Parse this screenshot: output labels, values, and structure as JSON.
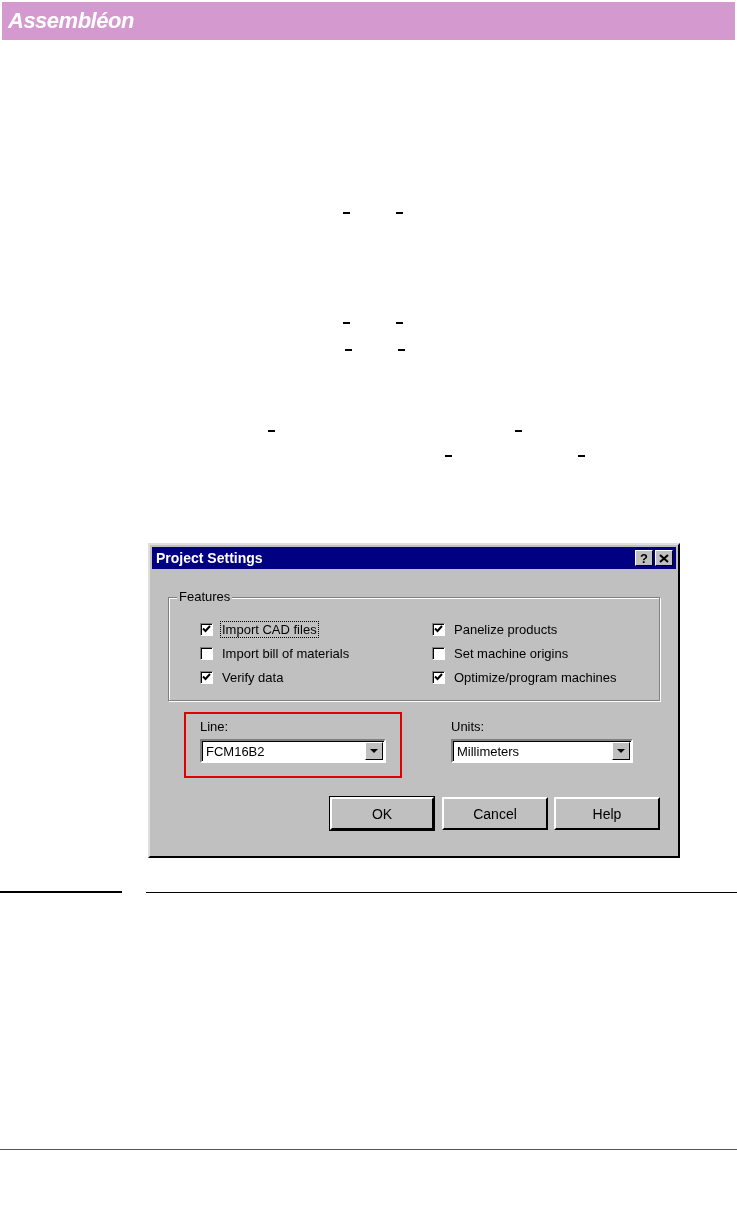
{
  "header": {
    "logo": "Assembléon"
  },
  "dialog": {
    "title": "Project Settings",
    "help_glyph": "?",
    "features": {
      "label": "Features",
      "options": [
        {
          "label": "Import CAD files",
          "checked": true,
          "focused": true
        },
        {
          "label": "Import bill of materials",
          "checked": false,
          "focused": false
        },
        {
          "label": "Verify data",
          "checked": true,
          "focused": false
        },
        {
          "label": "Panelize products",
          "checked": true,
          "focused": false
        },
        {
          "label": "Set machine origins",
          "checked": false,
          "focused": false
        },
        {
          "label": "Optimize/program machines",
          "checked": true,
          "focused": false
        }
      ]
    },
    "fields": [
      {
        "label": "Line:",
        "value": "FCM16B2",
        "highlighted": true
      },
      {
        "label": "Units:",
        "value": "Millimeters",
        "highlighted": false
      }
    ],
    "buttons": [
      {
        "label": "OK",
        "default": true
      },
      {
        "label": "Cancel",
        "default": false
      },
      {
        "label": "Help",
        "default": false
      }
    ]
  }
}
